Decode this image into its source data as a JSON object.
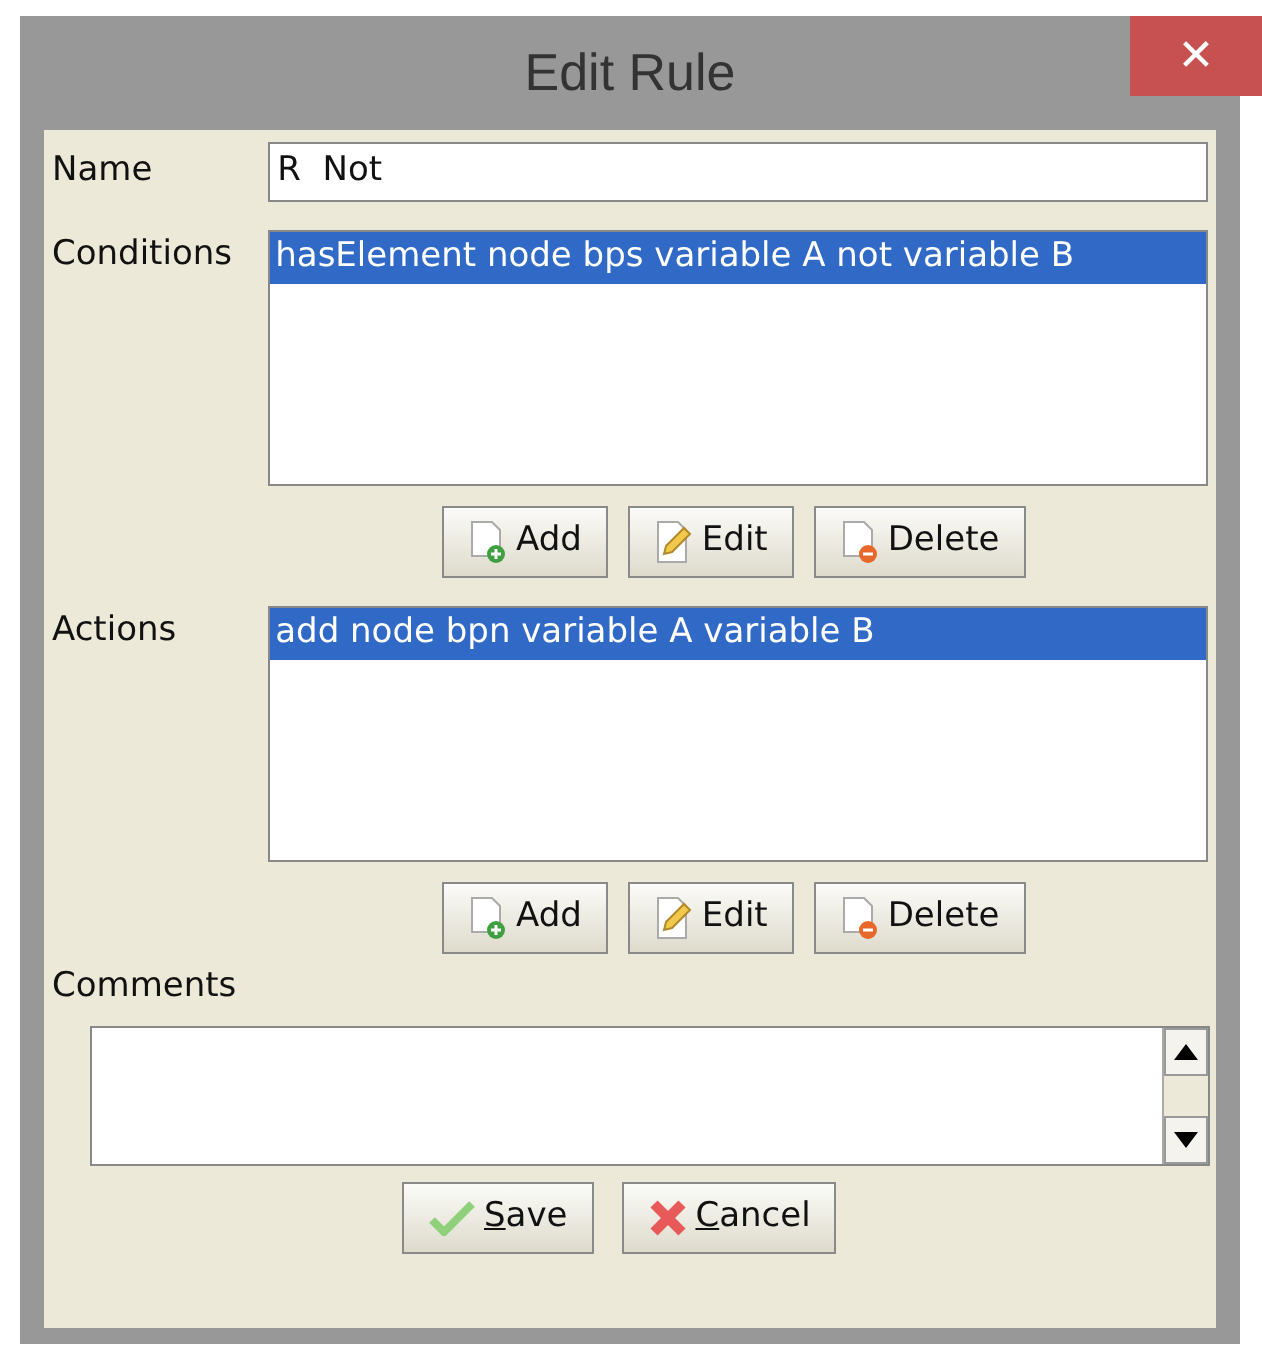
{
  "window": {
    "title": "Edit Rule",
    "close": "✕"
  },
  "name": {
    "label": "Name",
    "value": "R  Not"
  },
  "sections": [
    {
      "label": "Conditions",
      "items": [
        {
          "text": "hasElement node bps variable A not variable B",
          "selected": true
        }
      ],
      "buttons": [
        {
          "kind": "add",
          "label": "Add"
        },
        {
          "kind": "edit",
          "label": "Edit"
        },
        {
          "kind": "delete",
          "label": "Delete"
        }
      ]
    },
    {
      "label": "Actions",
      "items": [
        {
          "text": "add node bpn variable A variable B",
          "selected": true
        }
      ],
      "buttons": [
        {
          "kind": "add",
          "label": "Add"
        },
        {
          "kind": "edit",
          "label": "Edit"
        },
        {
          "kind": "delete",
          "label": "Delete"
        }
      ]
    }
  ],
  "comments": {
    "label": "Comments"
  },
  "footer": [
    {
      "kind": "save",
      "mnemonic": "S",
      "rest": "ave"
    },
    {
      "kind": "cancel",
      "mnemonic": "C",
      "rest": "ancel"
    }
  ]
}
